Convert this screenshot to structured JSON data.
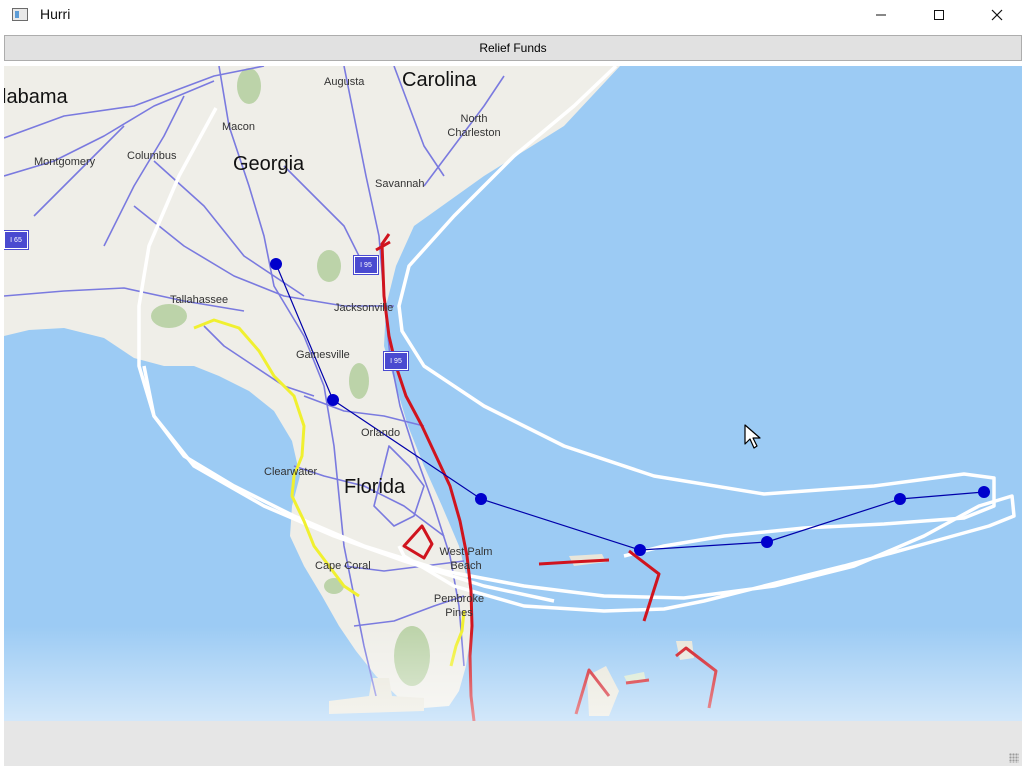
{
  "window": {
    "title": "Hurri"
  },
  "toolbar": {
    "relief_label": "Relief Funds"
  },
  "map": {
    "places": {
      "alabama": "labama",
      "carolina": "Carolina",
      "augusta": "Augusta",
      "macon": "Macon",
      "north_charleston": "North Charleston",
      "columbus": "Columbus",
      "montgomery": "Montgomery",
      "georgia": "Georgia",
      "savannah": "Savannah",
      "tallahassee": "Tallahassee",
      "jacksonville": "Jacksonville",
      "gainesville": "Gainesville",
      "orlando": "Orlando",
      "clearwater": "Clearwater",
      "florida": "Florida",
      "west_palm_beach": "West Palm Beach",
      "cape_coral": "Cape Coral",
      "pembroke_pines": "Pembroke Pines"
    },
    "shields": {
      "i65": "I 65",
      "i95_north": "I 95",
      "i95_south": "I 95"
    },
    "colors": {
      "ocean": "#9ccbf4",
      "land": "#efeee8",
      "track": "#0000cc",
      "warning": "#d0141e",
      "watch": "#f0f030",
      "cone": "#ffffff"
    }
  }
}
